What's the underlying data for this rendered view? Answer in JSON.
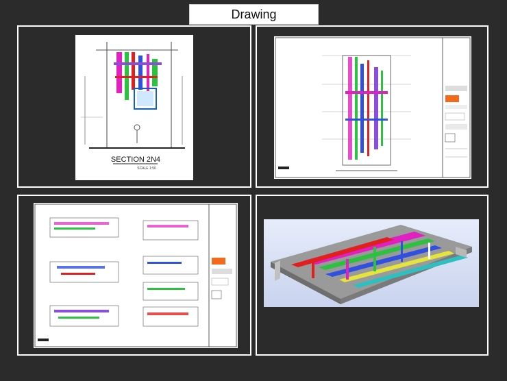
{
  "header": {
    "title": "Drawing"
  },
  "panels": {
    "top_left": {
      "caption": "SECTION 2N4",
      "scale": "SCALE 1:50"
    },
    "top_right": {},
    "bottom_left": {},
    "bottom_right": {}
  },
  "colors": {
    "background": "#2b2b2b",
    "frame": "#ffffff",
    "duct_magenta": "#e020c0",
    "duct_green": "#2ec040",
    "duct_blue": "#3050e0",
    "duct_red": "#e02020"
  }
}
